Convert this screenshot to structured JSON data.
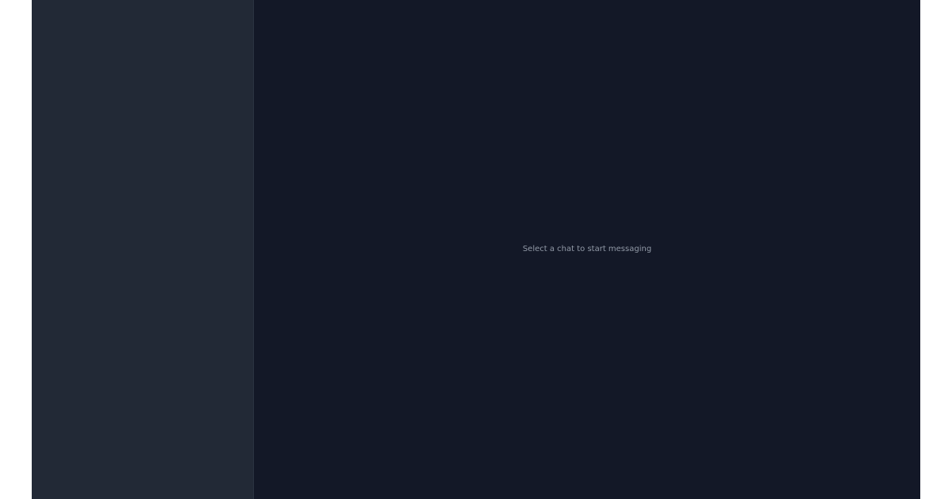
{
  "main": {
    "empty_state_text": "Select a chat to start messaging"
  },
  "colors": {
    "sidebar_bg": "#222936",
    "main_bg": "#131827",
    "muted_text": "#9199a6"
  }
}
